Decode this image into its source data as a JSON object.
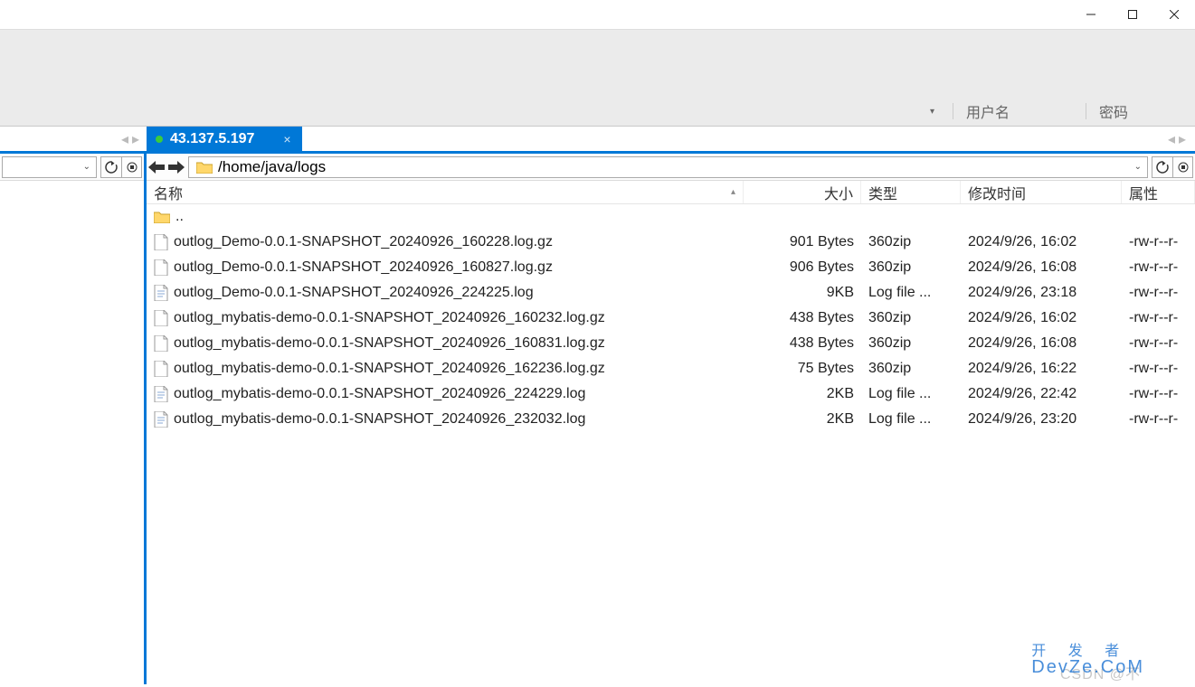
{
  "titlebar": {},
  "auth": {
    "label_user": "用户名",
    "label_pass": "密码"
  },
  "tab": {
    "host": "43.137.5.197"
  },
  "path_bar": {
    "path": "/home/java/logs"
  },
  "columns": {
    "name": "名称",
    "size": "大小",
    "type": "类型",
    "modified": "修改时间",
    "attr": "属性"
  },
  "parent_dir": "..",
  "files": [
    {
      "name": "outlog_Demo-0.0.1-SNAPSHOT_20240926_160228.log.gz",
      "size": "901 Bytes",
      "type": "360zip",
      "modified": "2024/9/26, 16:02",
      "attr": "-rw-r--r-",
      "icon": "gz"
    },
    {
      "name": "outlog_Demo-0.0.1-SNAPSHOT_20240926_160827.log.gz",
      "size": "906 Bytes",
      "type": "360zip",
      "modified": "2024/9/26, 16:08",
      "attr": "-rw-r--r-",
      "icon": "gz"
    },
    {
      "name": "outlog_Demo-0.0.1-SNAPSHOT_20240926_224225.log",
      "size": "9KB",
      "type": "Log file ...",
      "modified": "2024/9/26, 23:18",
      "attr": "-rw-r--r-",
      "icon": "log"
    },
    {
      "name": "outlog_mybatis-demo-0.0.1-SNAPSHOT_20240926_160232.log.gz",
      "size": "438 Bytes",
      "type": "360zip",
      "modified": "2024/9/26, 16:02",
      "attr": "-rw-r--r-",
      "icon": "gz"
    },
    {
      "name": "outlog_mybatis-demo-0.0.1-SNAPSHOT_20240926_160831.log.gz",
      "size": "438 Bytes",
      "type": "360zip",
      "modified": "2024/9/26, 16:08",
      "attr": "-rw-r--r-",
      "icon": "gz"
    },
    {
      "name": "outlog_mybatis-demo-0.0.1-SNAPSHOT_20240926_162236.log.gz",
      "size": "75 Bytes",
      "type": "360zip",
      "modified": "2024/9/26, 16:22",
      "attr": "-rw-r--r-",
      "icon": "gz"
    },
    {
      "name": "outlog_mybatis-demo-0.0.1-SNAPSHOT_20240926_224229.log",
      "size": "2KB",
      "type": "Log file ...",
      "modified": "2024/9/26, 22:42",
      "attr": "-rw-r--r-",
      "icon": "log"
    },
    {
      "name": "outlog_mybatis-demo-0.0.1-SNAPSHOT_20240926_232032.log",
      "size": "2KB",
      "type": "Log file ...",
      "modified": "2024/9/26, 23:20",
      "attr": "-rw-r--r-",
      "icon": "log"
    }
  ],
  "watermark": {
    "csdn": "CSDN @不",
    "brand_top": "开 发 者",
    "brand_bottom": "DevZe.CoM"
  }
}
